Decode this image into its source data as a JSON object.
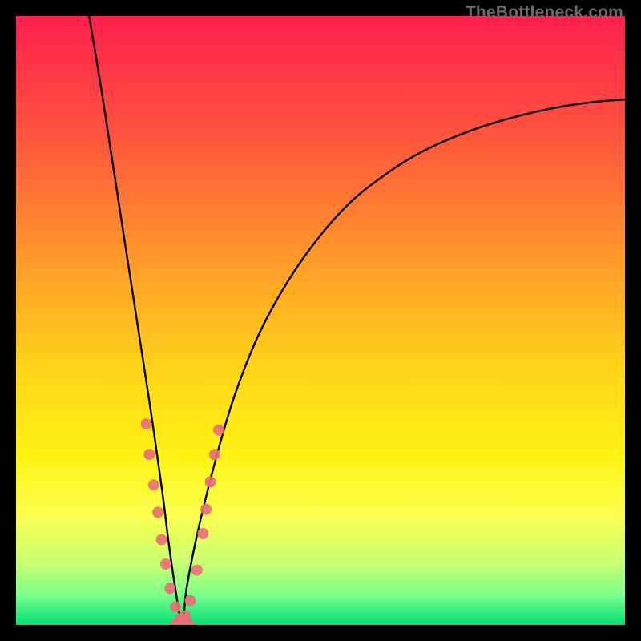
{
  "watermark": "TheBottleneck.com",
  "chart_data": {
    "type": "line",
    "title": "",
    "xlabel": "",
    "ylabel": "",
    "xlim": [
      0,
      100
    ],
    "ylim": [
      0,
      100
    ],
    "grid": false,
    "legend": false,
    "gradient_stops": [
      {
        "offset": 0.0,
        "color": "#ff1f4d"
      },
      {
        "offset": 0.18,
        "color": "#ff4f3f"
      },
      {
        "offset": 0.4,
        "color": "#ff9a2a"
      },
      {
        "offset": 0.58,
        "color": "#ffd419"
      },
      {
        "offset": 0.72,
        "color": "#fff215"
      },
      {
        "offset": 0.82,
        "color": "#faff4f"
      },
      {
        "offset": 0.9,
        "color": "#c8ff73"
      },
      {
        "offset": 0.95,
        "color": "#7cff88"
      },
      {
        "offset": 1.0,
        "color": "#00e077"
      }
    ],
    "series": [
      {
        "name": "curve",
        "x": [
          12.0,
          14.0,
          16.0,
          18.0,
          20.0,
          22.0,
          24.0,
          25.0,
          26.0,
          27.3,
          28.0,
          30.0,
          33.0,
          36.0,
          40.0,
          45.0,
          50.0,
          55.0,
          60.0,
          65.0,
          70.0,
          75.0,
          80.0,
          85.0,
          90.0,
          95.0,
          100.0
        ],
        "y": [
          100.0,
          88.0,
          75.0,
          62.0,
          49.0,
          36.0,
          22.0,
          14.0,
          7.0,
          0.0,
          6.0,
          16.0,
          28.0,
          38.0,
          48.0,
          57.0,
          64.0,
          69.5,
          73.5,
          76.8,
          79.3,
          81.3,
          82.9,
          84.2,
          85.2,
          85.9,
          86.3
        ]
      }
    ],
    "scatter": {
      "name": "markers",
      "color": "#e96f77",
      "radius": 7,
      "x": [
        21.4,
        21.9,
        22.6,
        23.3,
        23.9,
        24.6,
        25.3,
        26.2,
        27.0,
        27.8,
        28.6,
        29.7,
        30.7,
        31.2,
        31.9,
        32.6,
        33.3
      ],
      "y": [
        33.0,
        28.0,
        23.0,
        18.5,
        14.0,
        10.0,
        6.0,
        3.0,
        1.0,
        1.5,
        4.0,
        9.0,
        15.0,
        19.0,
        23.5,
        28.0,
        32.0
      ]
    },
    "bottom_bump": {
      "x_range": [
        25.0,
        29.6
      ],
      "height": 1.6,
      "color": "#e96f77"
    }
  }
}
